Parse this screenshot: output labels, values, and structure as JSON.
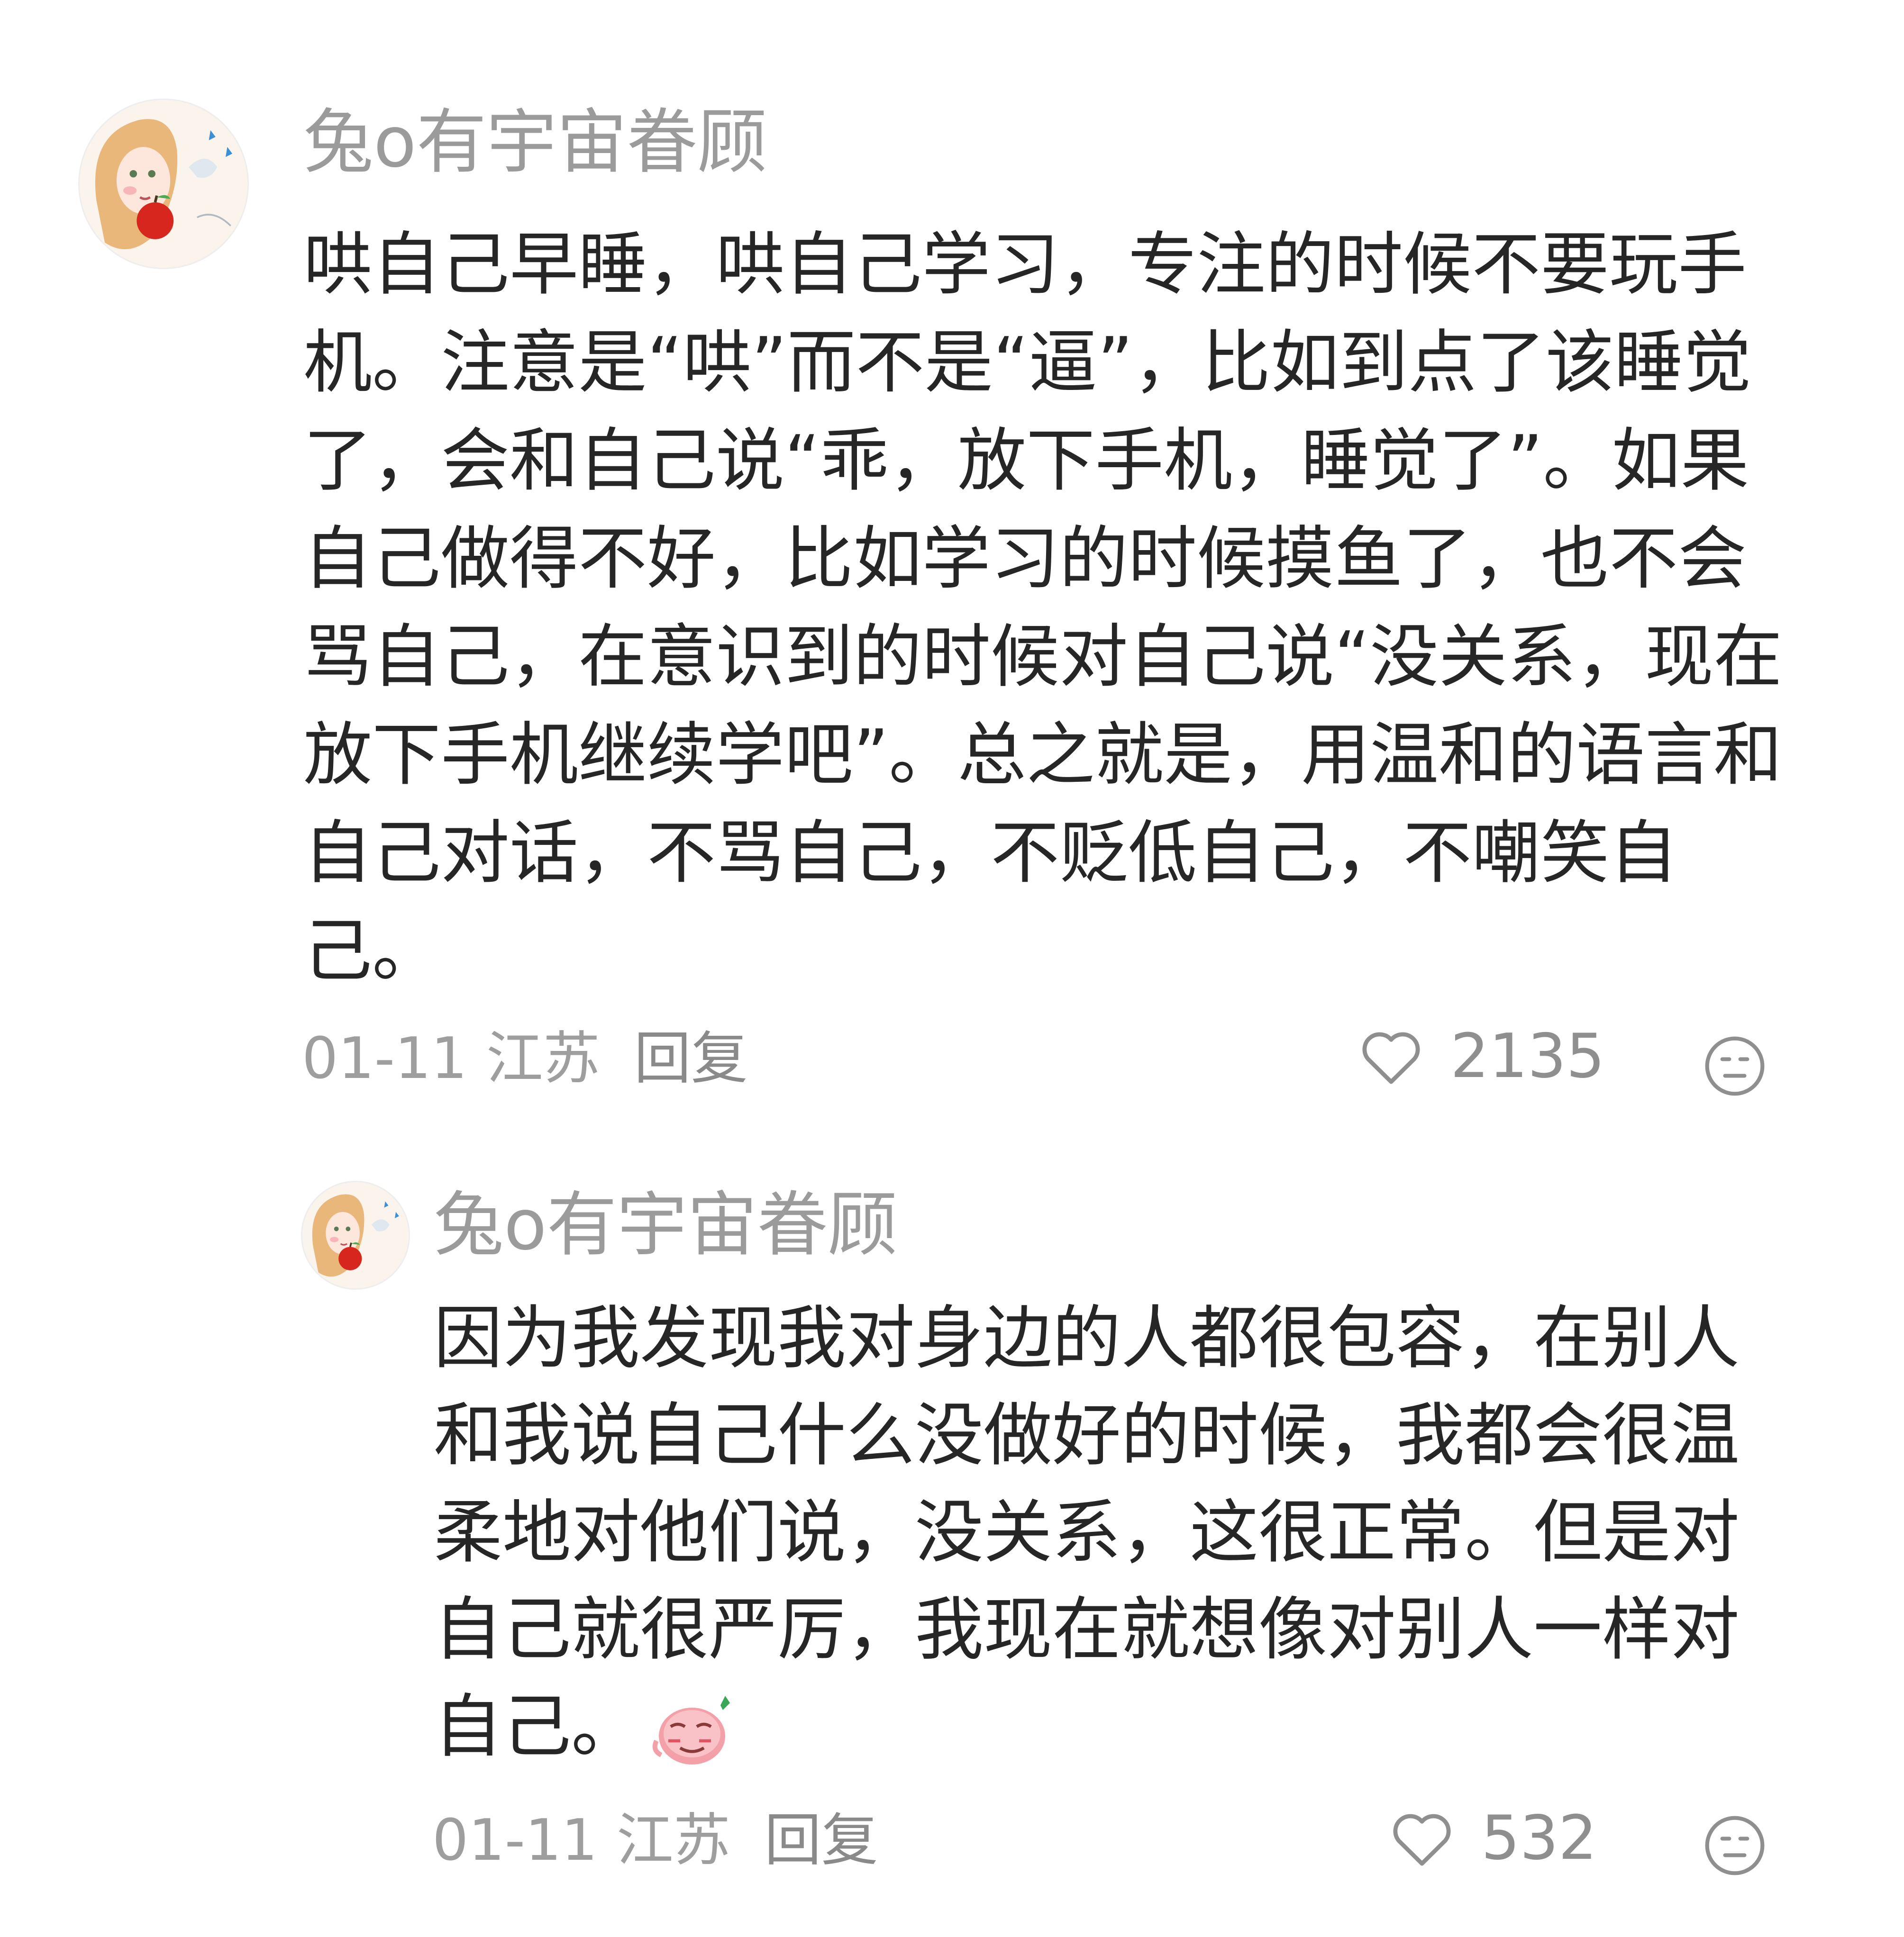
{
  "comments": [
    {
      "username": "兔o有宇宙眷顾",
      "text": "哄自己早睡，哄自己学习，专注的时候不要玩手机。注意是“哄”而不是“逼”，比如到点了该睡觉了，会和自己说“乖，放下手机，睡觉了”。如果自己做得不好，比如学习的时候摸鱼了，也不会骂自己，在意识到的时候对自己说“没关系，现在放下手机继续学吧”。总之就是，用温和的语言和自己对话，不骂自己，不贬低自己，不嘲笑自己。",
      "date": "01-11",
      "location": "江苏",
      "reply_label": "回复",
      "likes": "2135",
      "like_icon": "heart-outline-icon",
      "dislike_icon": "neutral-face-icon"
    },
    {
      "username": "兔o有宇宙眷顾",
      "text": "因为我发现我对身边的人都很包容，在别人和我说自己什么没做好的时候，我都会很温柔地对他们说，没关系，这很正常。但是对自己就很严厉，我现在就想像对别人一样对自己。",
      "emoji": "shy-blush-emoji",
      "date": "01-11",
      "location": "江苏",
      "reply_label": "回复",
      "likes": "532",
      "like_icon": "heart-outline-icon",
      "dislike_icon": "neutral-face-icon"
    }
  ],
  "colors": {
    "text": "#262626",
    "username": "#9b9b9b",
    "meta": "#9e9e9e",
    "icon": "#8f8f8f",
    "emoji_pink": "#f4a0a8",
    "emoji_leaf": "#3aa657"
  }
}
